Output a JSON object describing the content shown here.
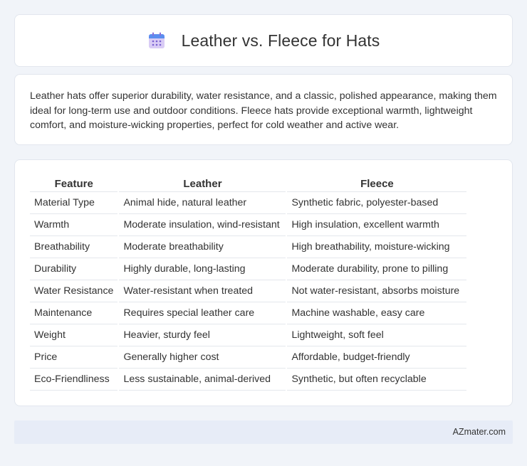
{
  "header": {
    "title": "Leather vs. Fleece for Hats",
    "icon": "calendar-icon"
  },
  "summary": {
    "text": "Leather hats offer superior durability, water resistance, and a classic, polished appearance, making them ideal for long-term use and outdoor conditions. Fleece hats provide exceptional warmth, lightweight comfort, and moisture-wicking properties, perfect for cold weather and active wear."
  },
  "table": {
    "headers": [
      "Feature",
      "Leather",
      "Fleece"
    ],
    "rows": [
      [
        "Material Type",
        "Animal hide, natural leather",
        "Synthetic fabric, polyester-based"
      ],
      [
        "Warmth",
        "Moderate insulation, wind-resistant",
        "High insulation, excellent warmth"
      ],
      [
        "Breathability",
        "Moderate breathability",
        "High breathability, moisture-wicking"
      ],
      [
        "Durability",
        "Highly durable, long-lasting",
        "Moderate durability, prone to pilling"
      ],
      [
        "Water Resistance",
        "Water-resistant when treated",
        "Not water-resistant, absorbs moisture"
      ],
      [
        "Maintenance",
        "Requires special leather care",
        "Machine washable, easy care"
      ],
      [
        "Weight",
        "Heavier, sturdy feel",
        "Lightweight, soft feel"
      ],
      [
        "Price",
        "Generally higher cost",
        "Affordable, budget-friendly"
      ],
      [
        "Eco-Friendliness",
        "Less sustainable, animal-derived",
        "Synthetic, but often recyclable"
      ]
    ]
  },
  "footer": {
    "text": "AZmater.com"
  },
  "colors": {
    "background": "#f1f4f9",
    "card": "#ffffff",
    "footer_bar": "#e7ecf7",
    "icon_accent": "#5b8def"
  }
}
